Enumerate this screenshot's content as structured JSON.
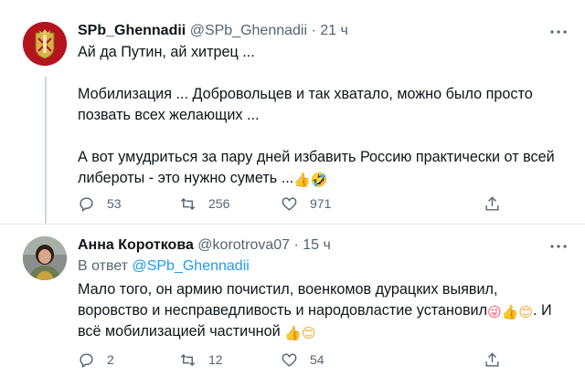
{
  "colors": {
    "link": "#1d9bf0",
    "secondary_text": "#536471",
    "primary_text": "#0f1419",
    "divider": "#e1e8ed"
  },
  "tweets": [
    {
      "display_name": "SPb_Ghennadii",
      "handle": "@SPb_Ghennadii",
      "separator": "·",
      "time": "21 ч",
      "avatar_icon": "coat-of-arms-icon",
      "lines": [
        "Ай да Путин, ай хитрец ...",
        "Мобилизация ... Добровольцев и так хватало, можно было просто",
        "позвать всех желающих ...",
        "А вот умудриться за пару дней избавить Россию практически от всей",
        "либероты - это нужно суметь ..."
      ],
      "emojis": {
        "thumbs_up": "👍",
        "rofl": "🤣"
      },
      "stats": {
        "replies": "53",
        "retweets": "256",
        "likes": "971"
      }
    },
    {
      "display_name": "Анна Короткова",
      "handle": "@korotrova07",
      "separator": "·",
      "time": "15 ч",
      "avatar_icon": "profile-photo-icon",
      "reply_prefix": "В ответ",
      "reply_handle": "@SPb_Ghennadii",
      "lines": [
        "Мало того, он армию почистил, военкомов дурацких выявил,",
        "воровство и несправедливость и народовластие установил",
        ". И",
        "всё мобилизацией частичной"
      ],
      "emojis": {
        "winking_tongue": "😜",
        "thumbs_up": "👍",
        "smile": "😊"
      },
      "stats": {
        "replies": "2",
        "retweets": "12",
        "likes": "54"
      }
    }
  ]
}
